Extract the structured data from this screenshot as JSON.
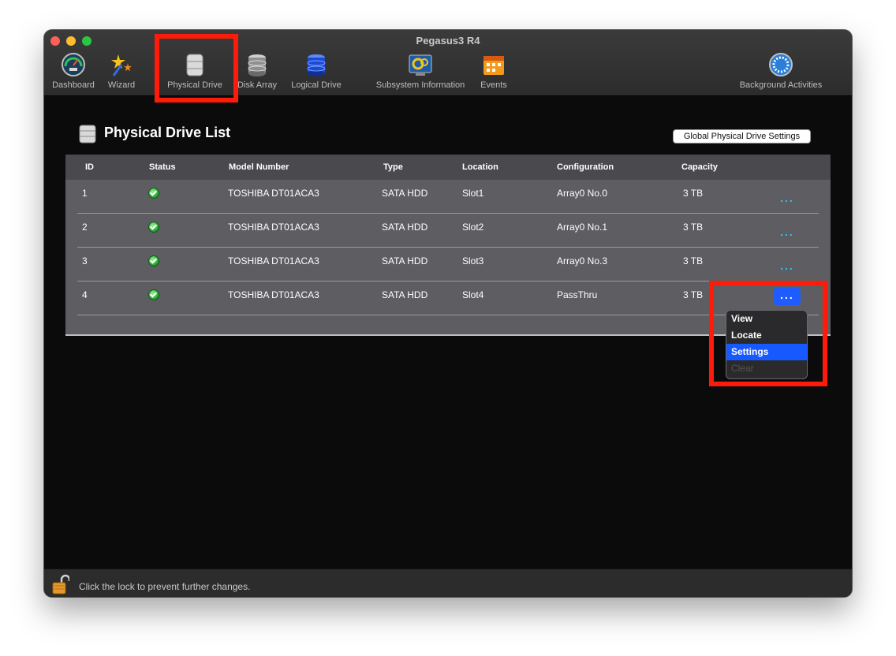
{
  "window": {
    "title": "Pegasus3 R4"
  },
  "toolbar": {
    "items": [
      {
        "label": "Dashboard",
        "icon": "gauge-icon"
      },
      {
        "label": "Wizard",
        "icon": "wizard-stars-icon"
      },
      {
        "label": "Physical Drive",
        "icon": "physical-drive-icon",
        "selected": true
      },
      {
        "label": "Disk Array",
        "icon": "disk-array-icon"
      },
      {
        "label": "Logical Drive",
        "icon": "logical-drive-icon"
      },
      {
        "label": "Subsystem Information",
        "icon": "subsystem-info-icon"
      },
      {
        "label": "Events",
        "icon": "events-calendar-icon"
      },
      {
        "label": "Background Activities",
        "icon": "background-activities-icon"
      }
    ]
  },
  "page": {
    "title": "Physical Drive List",
    "global_settings_label": "Global Physical Drive Settings"
  },
  "table": {
    "headers": [
      "ID",
      "Status",
      "Model Number",
      "Type",
      "Location",
      "Configuration",
      "Capacity"
    ],
    "rows": [
      {
        "id": "1",
        "status": "ok",
        "model": "TOSHIBA DT01ACA3",
        "type": "SATA HDD",
        "location": "Slot1",
        "configuration": "Array0 No.0",
        "capacity": "3 TB",
        "more": "..."
      },
      {
        "id": "2",
        "status": "ok",
        "model": "TOSHIBA DT01ACA3",
        "type": "SATA HDD",
        "location": "Slot2",
        "configuration": "Array0 No.1",
        "capacity": "3 TB",
        "more": "..."
      },
      {
        "id": "3",
        "status": "ok",
        "model": "TOSHIBA DT01ACA3",
        "type": "SATA HDD",
        "location": "Slot3",
        "configuration": "Array0 No.3",
        "capacity": "3 TB",
        "more": "..."
      },
      {
        "id": "4",
        "status": "ok",
        "model": "TOSHIBA DT01ACA3",
        "type": "SATA HDD",
        "location": "Slot4",
        "configuration": "PassThru",
        "capacity": "3 TB",
        "more": "..."
      }
    ]
  },
  "context_menu": {
    "items": [
      {
        "label": "View",
        "state": "normal"
      },
      {
        "label": "Locate",
        "state": "normal"
      },
      {
        "label": "Settings",
        "state": "selected"
      },
      {
        "label": "Clear",
        "state": "disabled"
      }
    ]
  },
  "statusbar": {
    "text": "Click the lock to prevent further changes."
  },
  "colors": {
    "highlight_box": "#ff1a0a",
    "menu_selected": "#1659ff",
    "more_link": "#2bc2ff"
  }
}
